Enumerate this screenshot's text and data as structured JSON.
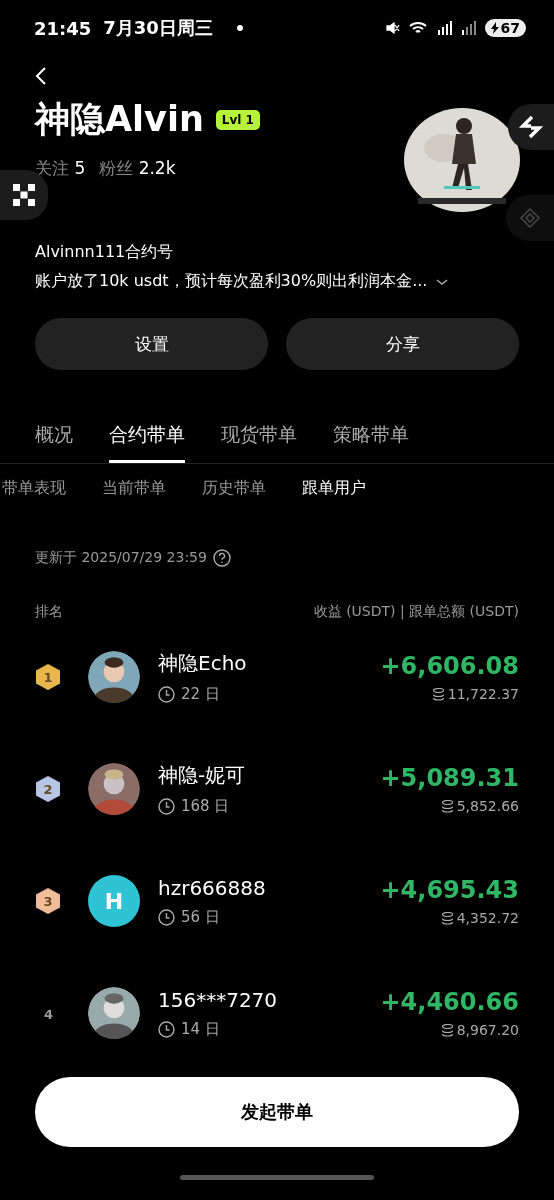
{
  "status_bar": {
    "time": "21:45",
    "date": "7月30日周三",
    "battery": "67"
  },
  "profile": {
    "name": "神隐Alvin",
    "level_badge": "Lvl 1",
    "stats": [
      {
        "label": "关注",
        "value": "5"
      },
      {
        "label": "粉丝",
        "value": "2.2k"
      }
    ],
    "account": "Alvinnn111合约号",
    "bio": "账户放了10k usdt，预计每次盈利30%则出利润本金..."
  },
  "buttons": [
    "设置",
    "分享"
  ],
  "tabs": [
    {
      "label": "概况",
      "selected": false
    },
    {
      "label": "合约带单",
      "selected": true
    },
    {
      "label": "现货带单",
      "selected": false
    },
    {
      "label": "策略带单",
      "selected": false
    }
  ],
  "sub_tabs": [
    {
      "label": "带单表现",
      "selected": false
    },
    {
      "label": "当前带单",
      "selected": false
    },
    {
      "label": "历史带单",
      "selected": false
    },
    {
      "label": "跟单用户",
      "selected": true
    }
  ],
  "updated": "更新于 2025/07/29 23:59",
  "table": {
    "columns": [
      "排名",
      "收益 (USDT) | 跟单总额 (USDT)"
    ],
    "rows": [
      {
        "rank": "1",
        "kind": "medal",
        "color": "#e8b64c",
        "name": "神隐Echo",
        "days": "22 日",
        "profit": "+6,606.08",
        "total": "11,722.37"
      },
      {
        "rank": "2",
        "kind": "medal",
        "color": "#b8c6e6",
        "name": "神隐-妮可",
        "days": "168 日",
        "profit": "+5,089.31",
        "total": "5,852.66"
      },
      {
        "rank": "3",
        "kind": "medal",
        "color": "#f0bc9a",
        "name": "hzr666888",
        "avatar": {
          "kind": "letter",
          "letter": "H"
        },
        "days": "56 日",
        "profit": "+4,695.43",
        "total": "4,352.72"
      },
      {
        "rank": "4",
        "kind": "plain",
        "name": "156***7270",
        "days": "14 日",
        "profit": "+4,460.66",
        "total": "8,967.20"
      }
    ]
  },
  "primary_button": "发起带单"
}
